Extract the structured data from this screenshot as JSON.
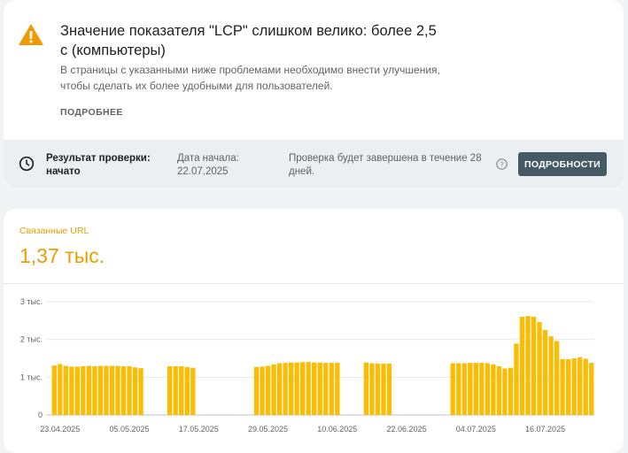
{
  "issue": {
    "title": "Значение показателя \"LCP\" слишком велико: более 2,5 с (компьютеры)",
    "description": "В страницы с указанными ниже проблемами необходимо внести улучшения, чтобы сделать их более удобными для пользователей.",
    "learn_more": "ПОДРОБНЕЕ",
    "icon": "warning-icon",
    "accent_color": "#f29900"
  },
  "validation": {
    "status": "Результат проверки: начато",
    "start_date": "Дата начала: 22.07.2025",
    "completion": "Проверка будет завершена в течение 28 дней.",
    "button": "ПОДРОБНОСТИ",
    "status_icon": "clock-icon",
    "help_icon": "help-icon",
    "button_color": "#455a64"
  },
  "urls": {
    "label": "Связанные URL",
    "count": "1,37 тыс.",
    "color": "#e8a000"
  },
  "chart_data": {
    "type": "bar",
    "color": "#fbbc04",
    "ylim": [
      0,
      3000
    ],
    "y_ticks": [
      {
        "value": 3000,
        "label": "3 тыс."
      },
      {
        "value": 2000,
        "label": "2 тыс."
      },
      {
        "value": 1000,
        "label": "1 тыс."
      },
      {
        "value": 0,
        "label": "0"
      }
    ],
    "x_labels": [
      "23.04.2025",
      "05.05.2025",
      "17.05.2025",
      "29.05.2025",
      "10.06.2025",
      "22.06.2025",
      "04.07.2025",
      "16.07.2025"
    ],
    "start_date": "22.04.2025",
    "dates": [
      "22.04.2025",
      "23.04.2025",
      "24.04.2025",
      "25.04.2025",
      "26.04.2025",
      "27.04.2025",
      "28.04.2025",
      "29.04.2025",
      "30.04.2025",
      "01.05.2025",
      "02.05.2025",
      "03.05.2025",
      "04.05.2025",
      "05.05.2025",
      "06.05.2025",
      "07.05.2025",
      "08.05.2025",
      "09.05.2025",
      "10.05.2025",
      "11.05.2025",
      "12.05.2025",
      "13.05.2025",
      "14.05.2025",
      "15.05.2025",
      "16.05.2025",
      "17.05.2025",
      "18.05.2025",
      "19.05.2025",
      "20.05.2025",
      "21.05.2025",
      "22.05.2025",
      "23.05.2025",
      "24.05.2025",
      "25.05.2025",
      "26.05.2025",
      "27.05.2025",
      "28.05.2025",
      "29.05.2025",
      "30.05.2025",
      "31.05.2025",
      "01.06.2025",
      "02.06.2025",
      "03.06.2025",
      "04.06.2025",
      "05.06.2025",
      "06.06.2025",
      "07.06.2025",
      "08.06.2025",
      "09.06.2025",
      "10.06.2025",
      "11.06.2025",
      "12.06.2025",
      "13.06.2025",
      "14.06.2025",
      "15.06.2025",
      "16.06.2025",
      "17.06.2025",
      "18.06.2025",
      "19.06.2025",
      "20.06.2025",
      "21.06.2025",
      "22.06.2025",
      "23.06.2025",
      "24.06.2025",
      "25.06.2025",
      "26.06.2025",
      "27.06.2025",
      "28.06.2025",
      "29.06.2025",
      "30.06.2025",
      "01.07.2025",
      "02.07.2025",
      "03.07.2025",
      "04.07.2025",
      "05.07.2025",
      "06.07.2025",
      "07.07.2025",
      "08.07.2025",
      "09.07.2025",
      "10.07.2025",
      "11.07.2025",
      "12.07.2025",
      "13.07.2025",
      "14.07.2025",
      "15.07.2025",
      "16.07.2025",
      "17.07.2025",
      "18.07.2025",
      "19.07.2025",
      "20.07.2025",
      "21.07.2025",
      "22.07.2025",
      "23.07.2025",
      "24.07.2025",
      "25.07.2025",
      "26.07.2025",
      "27.07.2025",
      "28.07.2025"
    ],
    "values": [
      1310,
      1350,
      1300,
      1280,
      1280,
      1290,
      1300,
      1290,
      1300,
      1300,
      1300,
      1300,
      1290,
      1290,
      1260,
      1240,
      null,
      null,
      null,
      null,
      1290,
      1290,
      1290,
      1270,
      1250,
      null,
      null,
      null,
      null,
      null,
      null,
      null,
      null,
      null,
      null,
      1270,
      1280,
      1300,
      1340,
      1370,
      1380,
      1390,
      1390,
      1400,
      1400,
      1390,
      1390,
      1380,
      1380,
      1380,
      null,
      null,
      null,
      null,
      1390,
      1370,
      1360,
      1360,
      1360,
      null,
      null,
      null,
      null,
      null,
      null,
      null,
      null,
      null,
      null,
      1370,
      1370,
      1370,
      1380,
      1380,
      1380,
      1370,
      1340,
      1290,
      1230,
      1250,
      1890,
      2600,
      2620,
      2600,
      2460,
      2250,
      2080,
      1960,
      1480,
      1480,
      1500,
      1530,
      1490,
      1380
    ]
  }
}
